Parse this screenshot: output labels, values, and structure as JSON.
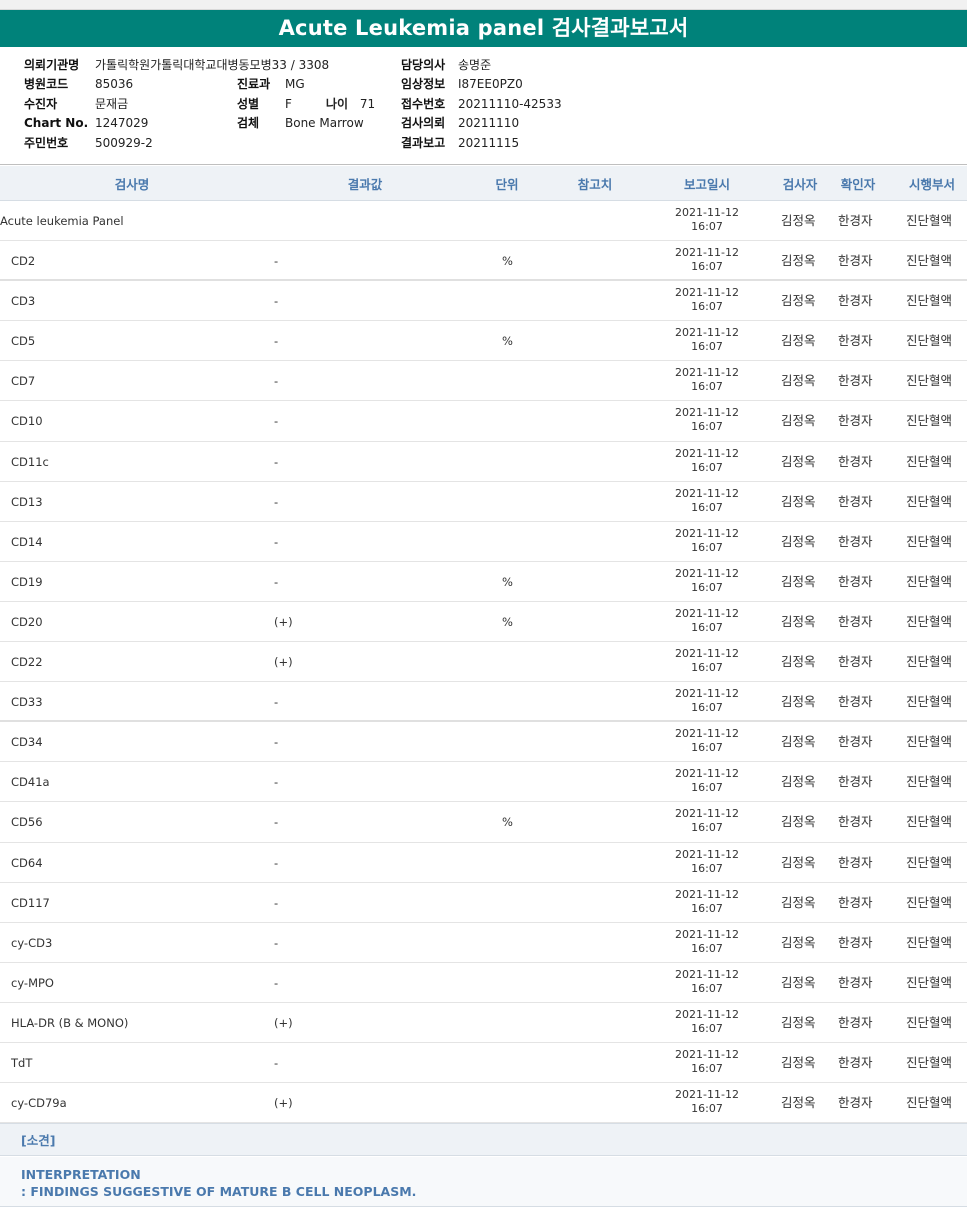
{
  "report": {
    "title": "Acute Leukemia panel 검사결과보고서"
  },
  "info": {
    "institution_label": "의뢰기관명",
    "institution": "가톨릭학원가톨릭대학교대병동모병33 / 3308",
    "hospital_code_label": "병원코드",
    "hospital_code": "85036",
    "patient_label": "수진자",
    "patient": "문재금",
    "chart_no_label": "Chart No.",
    "chart_no": "1247029",
    "resident_no_label": "주민번호",
    "resident_no": "500929-2",
    "department_label": "진료과",
    "department": "MG",
    "sex_label": "성별",
    "sex": "F",
    "age_label": "나이",
    "age": "71",
    "specimen_label": "검체",
    "specimen": "Bone Marrow",
    "doctor_label": "담당의사",
    "doctor": "송명준",
    "clinical_label": "임상정보",
    "clinical": "I87EE0PZ0",
    "accession_label": "접수번호",
    "accession": "20211110-42533",
    "request_label": "검사의뢰",
    "request": "20211110",
    "report_label": "결과보고",
    "report": "20211115"
  },
  "table": {
    "headers": {
      "name": "검사명",
      "result": "결과값",
      "unit": "단위",
      "reference": "참고치",
      "report_time": "보고일시",
      "tester": "검사자",
      "confirmer": "확인자",
      "dept": "시행부서"
    },
    "rows": [
      {
        "name": "Acute leukemia Panel",
        "result": "",
        "unit": "",
        "date": "2021-11-12",
        "time": "16:07",
        "tester": "김정옥",
        "confirmer": "한경자",
        "dept": "진단혈액"
      },
      {
        "name": "CD2",
        "result": "-",
        "unit": "%",
        "date": "2021-11-12",
        "time": "16:07",
        "tester": "김정옥",
        "confirmer": "한경자",
        "dept": "진단혈액"
      },
      {
        "name": "CD3",
        "result": "-",
        "unit": "",
        "date": "2021-11-12",
        "time": "16:07",
        "tester": "김정옥",
        "confirmer": "한경자",
        "dept": "진단혈액"
      },
      {
        "name": "CD5",
        "result": "-",
        "unit": "%",
        "date": "2021-11-12",
        "time": "16:07",
        "tester": "김정옥",
        "confirmer": "한경자",
        "dept": "진단혈액"
      },
      {
        "name": "CD7",
        "result": "-",
        "unit": "",
        "date": "2021-11-12",
        "time": "16:07",
        "tester": "김정옥",
        "confirmer": "한경자",
        "dept": "진단혈액"
      },
      {
        "name": "CD10",
        "result": "-",
        "unit": "",
        "date": "2021-11-12",
        "time": "16:07",
        "tester": "김정옥",
        "confirmer": "한경자",
        "dept": "진단혈액"
      },
      {
        "name": "CD11c",
        "result": "-",
        "unit": "",
        "date": "2021-11-12",
        "time": "16:07",
        "tester": "김정옥",
        "confirmer": "한경자",
        "dept": "진단혈액"
      },
      {
        "name": "CD13",
        "result": "-",
        "unit": "",
        "date": "2021-11-12",
        "time": "16:07",
        "tester": "김정옥",
        "confirmer": "한경자",
        "dept": "진단혈액"
      },
      {
        "name": "CD14",
        "result": "-",
        "unit": "",
        "date": "2021-11-12",
        "time": "16:07",
        "tester": "김정옥",
        "confirmer": "한경자",
        "dept": "진단혈액"
      },
      {
        "name": "CD19",
        "result": "-",
        "unit": "%",
        "date": "2021-11-12",
        "time": "16:07",
        "tester": "김정옥",
        "confirmer": "한경자",
        "dept": "진단혈액"
      },
      {
        "name": "CD20",
        "result": "(+)",
        "unit": "%",
        "date": "2021-11-12",
        "time": "16:07",
        "tester": "김정옥",
        "confirmer": "한경자",
        "dept": "진단혈액"
      },
      {
        "name": "CD22",
        "result": "(+)",
        "unit": "",
        "date": "2021-11-12",
        "time": "16:07",
        "tester": "김정옥",
        "confirmer": "한경자",
        "dept": "진단혈액"
      },
      {
        "name": "CD33",
        "result": "-",
        "unit": "",
        "date": "2021-11-12",
        "time": "16:07",
        "tester": "김정옥",
        "confirmer": "한경자",
        "dept": "진단혈액"
      },
      {
        "name": "CD34",
        "result": "-",
        "unit": "",
        "date": "2021-11-12",
        "time": "16:07",
        "tester": "김정옥",
        "confirmer": "한경자",
        "dept": "진단혈액"
      },
      {
        "name": "CD41a",
        "result": "-",
        "unit": "",
        "date": "2021-11-12",
        "time": "16:07",
        "tester": "김정옥",
        "confirmer": "한경자",
        "dept": "진단혈액"
      },
      {
        "name": "CD56",
        "result": "-",
        "unit": "%",
        "date": "2021-11-12",
        "time": "16:07",
        "tester": "김정옥",
        "confirmer": "한경자",
        "dept": "진단혈액"
      },
      {
        "name": "CD64",
        "result": "-",
        "unit": "",
        "date": "2021-11-12",
        "time": "16:07",
        "tester": "김정옥",
        "confirmer": "한경자",
        "dept": "진단혈액"
      },
      {
        "name": "CD117",
        "result": "-",
        "unit": "",
        "date": "2021-11-12",
        "time": "16:07",
        "tester": "김정옥",
        "confirmer": "한경자",
        "dept": "진단혈액"
      },
      {
        "name": "cy-CD3",
        "result": "-",
        "unit": "",
        "date": "2021-11-12",
        "time": "16:07",
        "tester": "김정옥",
        "confirmer": "한경자",
        "dept": "진단혈액"
      },
      {
        "name": "cy-MPO",
        "result": "-",
        "unit": "",
        "date": "2021-11-12",
        "time": "16:07",
        "tester": "김정옥",
        "confirmer": "한경자",
        "dept": "진단혈액"
      },
      {
        "name": "HLA-DR (B & MONO)",
        "result": "(+)",
        "unit": "",
        "date": "2021-11-12",
        "time": "16:07",
        "tester": "김정옥",
        "confirmer": "한경자",
        "dept": "진단혈액"
      },
      {
        "name": "TdT",
        "result": "-",
        "unit": "",
        "date": "2021-11-12",
        "time": "16:07",
        "tester": "김정옥",
        "confirmer": "한경자",
        "dept": "진단혈액"
      },
      {
        "name": "cy-CD79a",
        "result": "(+)",
        "unit": "",
        "date": "2021-11-12",
        "time": "16:07",
        "tester": "김정옥",
        "confirmer": "한경자",
        "dept": "진단혈액"
      }
    ]
  },
  "remarks": {
    "heading": "[소견]",
    "line1": "INTERPRETATION",
    "line2": " : FINDINGS SUGGESTIVE OF MATURE B CELL NEOPLASM."
  }
}
